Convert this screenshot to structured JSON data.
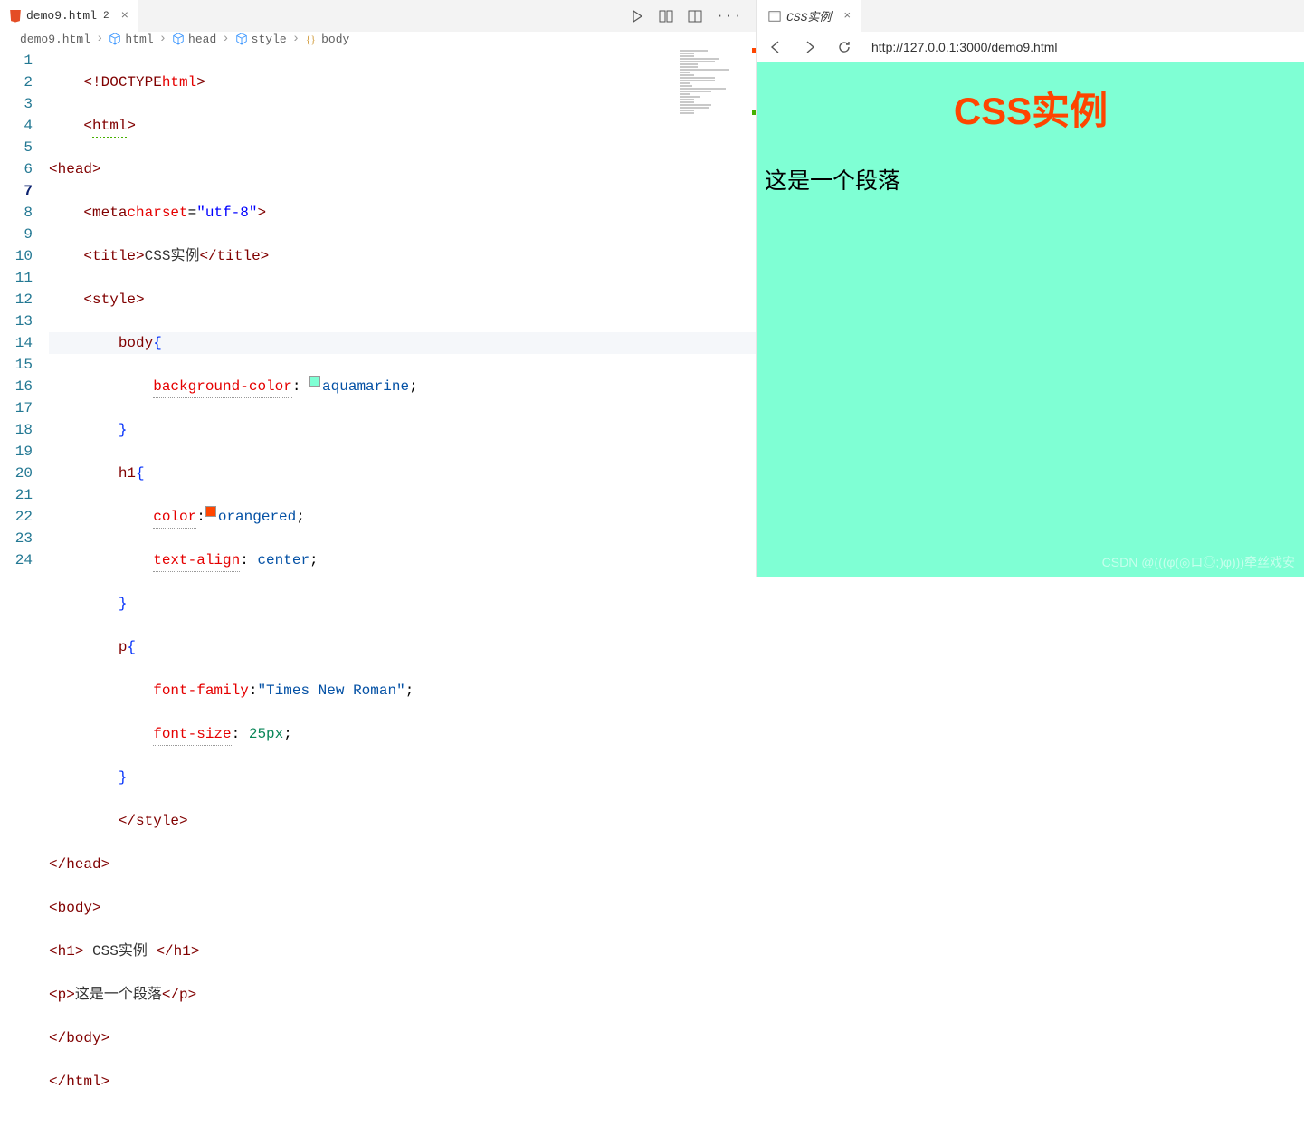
{
  "editor": {
    "tab": {
      "filename": "demo9.html",
      "dirty_count": "2"
    },
    "breadcrumbs": [
      {
        "icon": "html5",
        "label": "demo9.html"
      },
      {
        "icon": "cube",
        "label": "html"
      },
      {
        "icon": "cube",
        "label": "head"
      },
      {
        "icon": "cube",
        "label": "style"
      },
      {
        "icon": "brace",
        "label": "body"
      }
    ],
    "active_line": 7,
    "lines": {
      "l1": "<!DOCTYPE html>",
      "l2": "<html>",
      "l3": "<head>",
      "l4_tag": "meta",
      "l4_attr": "charset",
      "l4_val": "\"utf-8\"",
      "l5_open": "title",
      "l5_txt": "CSS实例",
      "l5_close": "title",
      "l6": "style",
      "l7_sel": "body",
      "l8_prop": "background-color",
      "l8_val": "aquamarine",
      "l8_color": "#7fffd4",
      "l10_sel": "h1",
      "l11_prop": "color",
      "l11_val": "orangered",
      "l11_color": "#ff4500",
      "l12_prop": "text-align",
      "l12_val": "center",
      "l14_sel": "p",
      "l15_prop": "font-family",
      "l15_val": "\"Times New Roman\"",
      "l16_prop": "font-size",
      "l16_val": "25px",
      "l18": "style",
      "l19": "head",
      "l20": "body",
      "l21_open": "h1",
      "l21_txt": " CSS实例 ",
      "l21_close": "h1",
      "l22_open": "p",
      "l22_txt": "这是一个段落",
      "l22_close": "p",
      "l23": "body",
      "l24": "html"
    }
  },
  "preview": {
    "tab_title": "CSS实例",
    "url": "http://127.0.0.1:3000/demo9.html",
    "h1": "CSS实例",
    "p": "这是一个段落"
  },
  "watermark": "CSDN @(((φ(◎ロ◎;)φ)))牵丝戏安"
}
